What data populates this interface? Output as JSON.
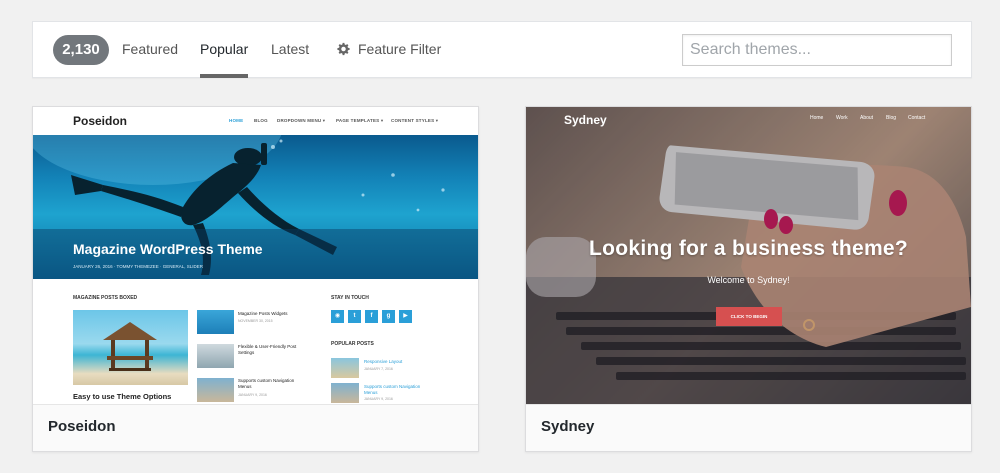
{
  "filter_bar": {
    "count": "2,130",
    "tabs": [
      {
        "label": "Featured",
        "current": false
      },
      {
        "label": "Popular",
        "current": true
      },
      {
        "label": "Latest",
        "current": false
      }
    ],
    "feature_filter": {
      "label": "Feature Filter",
      "icon": "gear-icon"
    },
    "search": {
      "value": "",
      "placeholder": "Search themes..."
    }
  },
  "themes": [
    {
      "name": "Poseidon",
      "preview": {
        "logo": "Poseidon",
        "nav": [
          "HOME",
          "BLOG",
          "DROPDOWN MENU ▾",
          "PAGE TEMPLATES ▾",
          "CONTENT STYLES ▾"
        ],
        "hero_title": "Magazine WordPress Theme",
        "hero_meta": "JANUARY 26, 2016  ·  TOMMY THEMEZEE  ·  GENERAL, SLIDER",
        "section_boxed": "MAGAZINE POSTS BOXED",
        "big_post": "Easy to use Theme Options",
        "small_posts": [
          {
            "title": "Magazine Posts Widgets",
            "date": "NOVEMBER 30, 2015"
          },
          {
            "title": "Flexible & User-Friendly Post Settings",
            "date": ""
          },
          {
            "title": "Supports custom Navigation Menus",
            "date": "JANUARY 9, 2016"
          }
        ],
        "section_social": "STAY IN TOUCH",
        "social_icons": [
          "rss-icon",
          "twitter-icon",
          "facebook-icon",
          "googleplus-icon",
          "youtube-icon"
        ],
        "section_popular": "POPULAR POSTS",
        "popular_posts": [
          {
            "title": "Responsive Layout",
            "date": "JANUARY 7, 2016"
          },
          {
            "title": "Supports custom Navigation Menus",
            "date": "JANUARY 9, 2016"
          }
        ]
      }
    },
    {
      "name": "Sydney",
      "preview": {
        "logo": "Sydney",
        "nav": [
          "Home",
          "Work",
          "About",
          "Blog",
          "Contact"
        ],
        "headline": "Looking for a business theme?",
        "subline": "Welcome to Sydney!",
        "button": "CLICK TO BEGIN"
      }
    }
  ],
  "colors": {
    "page_bg": "#f1f1f1",
    "count_badge": "#72777c",
    "poseidon_accent": "#2a9fd8",
    "sydney_button": "#d65050"
  }
}
